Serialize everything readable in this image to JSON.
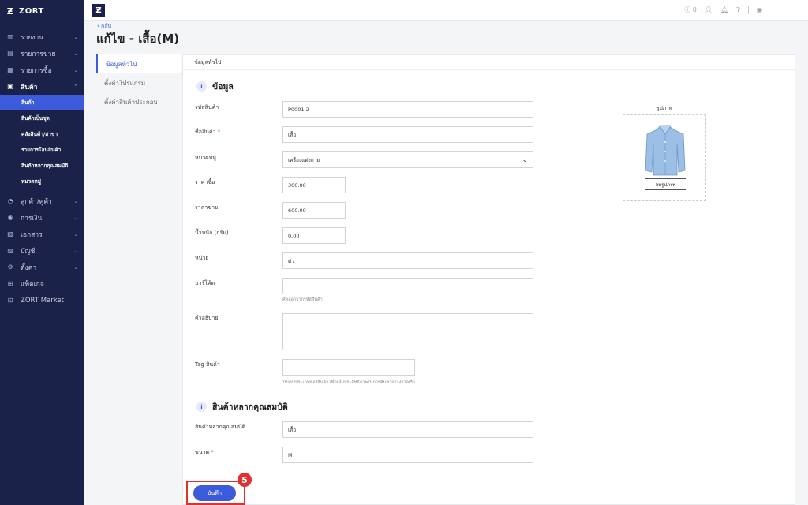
{
  "brand": {
    "name": "ZORT",
    "mark": "Ƶ"
  },
  "sidebar": {
    "items": [
      {
        "label": "รายงาน",
        "icon": "chart-icon"
      },
      {
        "label": "รายการขาย",
        "icon": "receipt-icon"
      },
      {
        "label": "รายการซื้อ",
        "icon": "cart-icon"
      },
      {
        "label": "สินค้า",
        "icon": "box-icon"
      },
      {
        "label": "ลูกค้า/คู่ค้า",
        "icon": "handshake-icon"
      },
      {
        "label": "การเงิน",
        "icon": "coin-icon"
      },
      {
        "label": "เอกสาร",
        "icon": "document-icon"
      },
      {
        "label": "บัญชี",
        "icon": "ledger-icon"
      },
      {
        "label": "ตั้งค่า",
        "icon": "gear-icon"
      },
      {
        "label": "แพ็คเกจ",
        "icon": "package-icon"
      },
      {
        "label": "ZORT Market",
        "icon": "market-icon"
      }
    ],
    "subitems": [
      {
        "label": "สินค้า"
      },
      {
        "label": "สินค้าเป็นชุด"
      },
      {
        "label": "คลังสินค้า/สาขา"
      },
      {
        "label": "รายการโอนสินค้า"
      },
      {
        "label": "สินค้าหลากคุณสมบัติ"
      },
      {
        "label": "หมวดหมู่"
      }
    ]
  },
  "topbar": {
    "count": "0"
  },
  "header": {
    "back": "‹ กลับ",
    "title": "แก้ไข - เสื้อ(M)"
  },
  "tabs": [
    {
      "label": "ข้อมูลทั่วไป"
    },
    {
      "label": "ตั้งค่าโปรแกรม"
    },
    {
      "label": "ตั้งค่าสินค้าประกอบ"
    }
  ],
  "card": {
    "head": "ข้อมูลทั่วไป",
    "section1": "ข้อมูล",
    "section2": "สินค้าหลากคุณสมบัติ",
    "image_title": "รูปภาพ",
    "delete_image": "ลบรูปภาพ"
  },
  "form": {
    "sku_label": "รหัสสินค้า",
    "sku": "P0001-2",
    "name_label": "ชื่อสินค้า",
    "name": "เสื้อ",
    "category_label": "หมวดหมู่",
    "category": "เครื่องแต่งกาย",
    "cost_label": "ราคาซื้อ",
    "cost": "300.00",
    "price_label": "ราคาขาย",
    "price": "600.00",
    "weight_label": "น้ำหนัก (กรัม)",
    "weight": "0.00",
    "unit_label": "หน่วย",
    "unit": "ตัว",
    "barcode_label": "บาร์โค้ด",
    "barcode": "",
    "barcode_hint": "คัดลอกจากรหัสสินค้า",
    "desc_label": "คำอธิบาย",
    "tag_label": "Tag สินค้า",
    "tag_hint": "ใช้แบ่งประเภทของสินค้า เพื่อเพิ่มประสิทธิภาพในการค้นหาอย่างรวดเร็ว",
    "variant_label": "สินค้าหลากคุณสมบัติ",
    "variant": "เสื้อ",
    "size_label": "ขนาด",
    "size": "M",
    "required_mark": "*"
  },
  "save_label": "บันทึก",
  "step_number": "5",
  "colors": {
    "sidebar": "#1b2249",
    "accent": "#3b5bdb",
    "highlight": "#e03131"
  }
}
